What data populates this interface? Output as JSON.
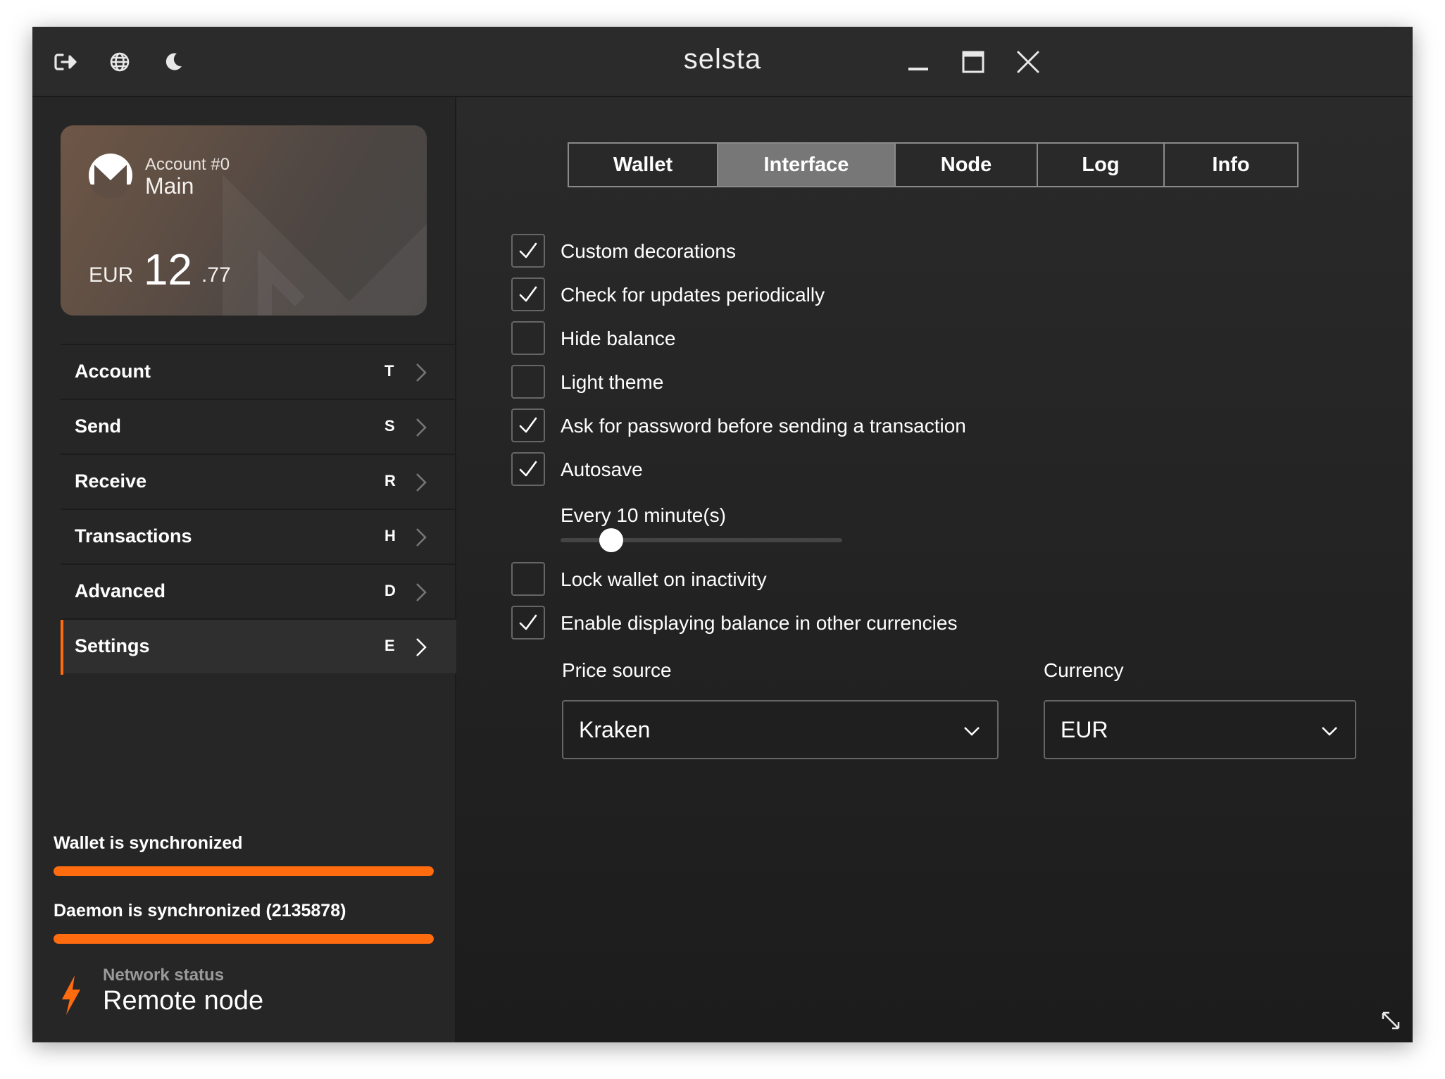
{
  "app": {
    "title": "selsta"
  },
  "titlebar": {
    "icons": [
      "logout-icon",
      "globe-icon",
      "moon-icon"
    ],
    "window_controls": [
      "minimize-icon",
      "maximize-icon",
      "close-icon"
    ]
  },
  "account_card": {
    "account_number": "Account #0",
    "account_name": "Main",
    "currency": "EUR",
    "balance_int": "12",
    "balance_dec": ".77"
  },
  "sidebar": {
    "items": [
      {
        "label": "Account",
        "key": "T"
      },
      {
        "label": "Send",
        "key": "S"
      },
      {
        "label": "Receive",
        "key": "R"
      },
      {
        "label": "Transactions",
        "key": "H"
      },
      {
        "label": "Advanced",
        "key": "D"
      },
      {
        "label": "Settings",
        "key": "E",
        "active": true
      }
    ],
    "wallet_sync": {
      "label": "Wallet is synchronized",
      "progress": 1.0
    },
    "daemon_sync": {
      "label": "Daemon is synchronized (2135878)",
      "progress": 1.0
    },
    "network": {
      "label": "Network status",
      "value": "Remote node"
    }
  },
  "tabs": [
    {
      "label": "Wallet"
    },
    {
      "label": "Interface",
      "active": true
    },
    {
      "label": "Node"
    },
    {
      "label": "Log"
    },
    {
      "label": "Info"
    }
  ],
  "options": [
    {
      "label": "Custom decorations",
      "checked": true
    },
    {
      "label": "Check for updates periodically",
      "checked": true
    },
    {
      "label": "Hide balance",
      "checked": false
    },
    {
      "label": "Light theme",
      "checked": false
    },
    {
      "label": "Ask for password before sending a transaction",
      "checked": true
    },
    {
      "label": "Autosave",
      "checked": true
    },
    {
      "label": "Lock wallet on inactivity",
      "checked": false
    },
    {
      "label": "Enable displaying balance in other currencies",
      "checked": true
    }
  ],
  "autosave_slider": {
    "label": "Every 10 minute(s)",
    "value": 0.18
  },
  "price_source": {
    "label": "Price source",
    "value": "Kraken"
  },
  "currency": {
    "label": "Currency",
    "value": "EUR"
  },
  "colors": {
    "accent": "#ff6b0f",
    "background": "#232323",
    "tab_active": "#777777"
  }
}
